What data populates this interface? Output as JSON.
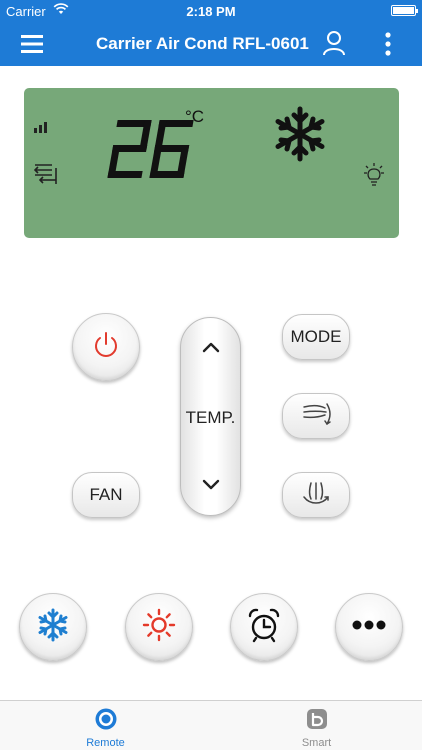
{
  "status_bar": {
    "carrier": "Carrier",
    "time": "2:18 PM"
  },
  "nav": {
    "title": "Carrier Air Cond RFL-0601",
    "menu_icon": "hamburger-menu-icon",
    "user_icon": "user-icon",
    "more_icon": "vertical-more-icon"
  },
  "display": {
    "temperature": "26",
    "unit": "°C",
    "mode_icon": "snowflake-icon",
    "fan_icon": "signal-bars-icon",
    "swing_icon": "swing-icon",
    "light_icon": "light-bulb-icon"
  },
  "controls": {
    "mode_label": "MODE",
    "fan_label": "FAN",
    "temp_label": "TEMP."
  },
  "colors": {
    "accent": "#1e7bd6",
    "lcd": "#77a879",
    "power": "#e23b2e",
    "cool": "#1f7fd0",
    "heat": "#e43a2a"
  },
  "tabs": [
    {
      "label": "Remote",
      "icon": "remote-target-icon",
      "active": true
    },
    {
      "label": "Smart",
      "icon": "smart-b-icon",
      "active": false
    }
  ]
}
